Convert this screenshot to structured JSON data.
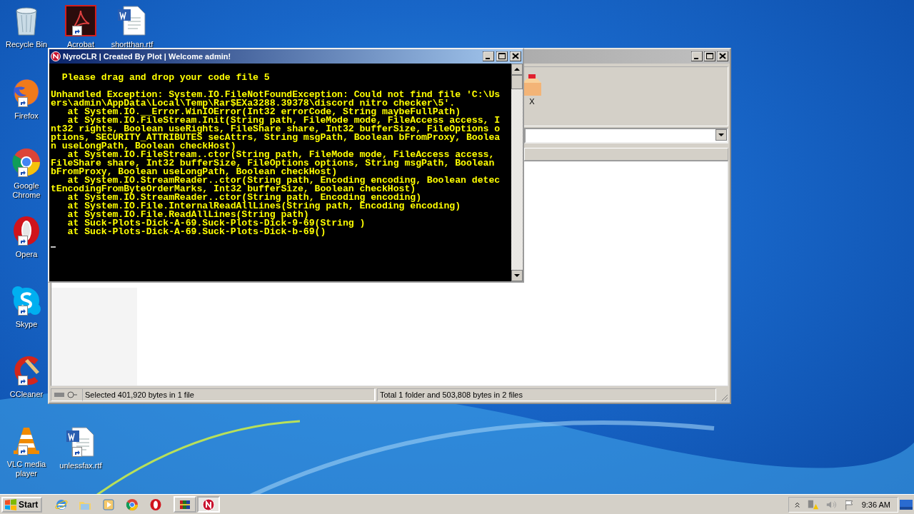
{
  "desktop_icons": [
    {
      "label": "Recycle Bin"
    },
    {
      "label": "Acrobat"
    },
    {
      "label": "shortthan.rtf"
    },
    {
      "label": "Firefox"
    },
    {
      "label": "Google Chrome"
    },
    {
      "label": "Opera"
    },
    {
      "label": "Skype"
    },
    {
      "label": "CCleaner"
    },
    {
      "label": "VLC media player"
    },
    {
      "label": "unlessfax.rtf"
    }
  ],
  "archive_window": {
    "toolbar_label": "X",
    "status_bar": [
      "Selected 401,920 bytes in 1 file",
      "Total 1 folder and 503,808 bytes in 2 files"
    ]
  },
  "console_window": {
    "title": "NyroCLR | Created By Plot | Welcome admin!",
    "prompt": "  Please drag and drop your code file 5",
    "lines": [
      "Unhandled Exception: System.IO.FileNotFoundException: Could not find file 'C:\\Us",
      "ers\\admin\\AppData\\Local\\Temp\\Rar$EXa3288.39378\\discord nitro checker\\5'.",
      "   at System.IO.__Error.WinIOError(Int32 errorCode, String maybeFullPath)",
      "   at System.IO.FileStream.Init(String path, FileMode mode, FileAccess access, I",
      "nt32 rights, Boolean useRights, FileShare share, Int32 bufferSize, FileOptions o",
      "ptions, SECURITY_ATTRIBUTES secAttrs, String msgPath, Boolean bFromProxy, Boolea",
      "n useLongPath, Boolean checkHost)",
      "   at System.IO.FileStream..ctor(String path, FileMode mode, FileAccess access,",
      "FileShare share, Int32 bufferSize, FileOptions options, String msgPath, Boolean",
      "bFromProxy, Boolean useLongPath, Boolean checkHost)",
      "   at System.IO.StreamReader..ctor(String path, Encoding encoding, Boolean detec",
      "tEncodingFromByteOrderMarks, Int32 bufferSize, Boolean checkHost)",
      "   at System.IO.StreamReader..ctor(String path, Encoding encoding)",
      "   at System.IO.File.InternalReadAllLines(String path, Encoding encoding)",
      "   at System.IO.File.ReadAllLines(String path)",
      "   at Suck-Plots-Dick-A-69.Suck-Plots-Dick-9-69(String )",
      "   at Suck-Plots-Dick-A-69.Suck-Plots-Dick-b-69()"
    ]
  },
  "taskbar": {
    "start_label": "Start",
    "tasks": [
      {
        "selected": false
      },
      {
        "selected": true
      }
    ],
    "clock": "9:36 AM"
  }
}
